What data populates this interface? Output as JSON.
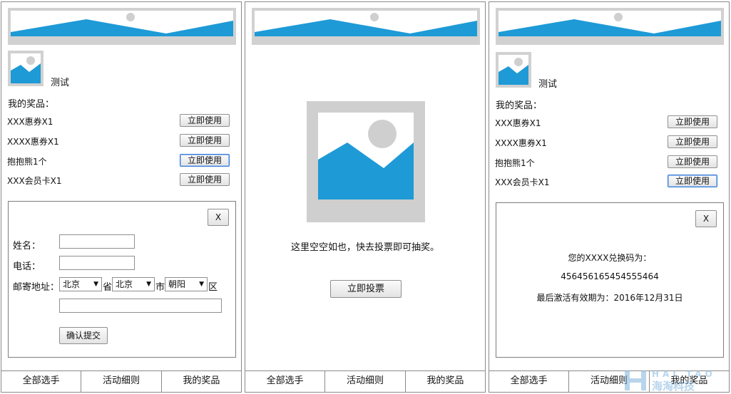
{
  "colors": {
    "accent": "#1e9ad6",
    "placeholder_gray": "#d1d1d1",
    "border": "#8a8a8a"
  },
  "left": {
    "username": "测试",
    "prizes_title": "我的奖品：",
    "prizes": [
      {
        "name": "XXX惠券X1",
        "button": "立即使用"
      },
      {
        "name": "XXXX惠券X1",
        "button": "立即使用"
      },
      {
        "name": "抱抱熊1个",
        "button": "立即使用"
      },
      {
        "name": "XXX会员卡X1",
        "button": "立即使用"
      }
    ],
    "dialog": {
      "close_label": "X",
      "name_label": "姓名：",
      "phone_label": "电话：",
      "address_label": "邮寄地址：",
      "province_value": "北京",
      "province_suffix": "省",
      "city_value": "北京",
      "city_suffix": "市",
      "district_value": "朝阳",
      "district_suffix": "区",
      "submit_label": "确认提交"
    }
  },
  "middle": {
    "empty_text": "这里空空如也，快去投票即可抽奖。",
    "vote_button": "立即投票"
  },
  "right": {
    "username": "测试",
    "prizes_title": "我的奖品：",
    "prizes": [
      {
        "name": "XXX惠券X1",
        "button": "立即使用"
      },
      {
        "name": "XXXX惠券X1",
        "button": "立即使用"
      },
      {
        "name": "抱抱熊1个",
        "button": "立即使用"
      },
      {
        "name": "XXX会员卡X1",
        "button": "立即使用"
      }
    ],
    "dialog": {
      "close_label": "X",
      "code_title": "您的XXXX兑换码为：",
      "code_value": "456456165454555464",
      "expiry_text": "最后激活有效期为：2016年12月31日"
    }
  },
  "tabs": [
    "全部选手",
    "活动细则",
    "我的奖品"
  ],
  "watermark": {
    "top": "HAI TAO",
    "bottom": "海淘科技"
  }
}
